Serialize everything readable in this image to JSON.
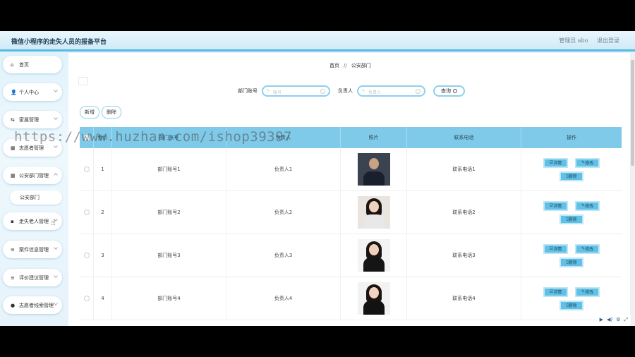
{
  "app_title": "微信小程序的走失人员的报备平台",
  "header": {
    "user_label": "管理员 abo",
    "logout": "退出登录"
  },
  "sidebar": {
    "items": [
      {
        "icon": "home-icon",
        "glyph": "⌂",
        "label": "首页"
      },
      {
        "icon": "user-icon",
        "glyph": "👤",
        "label": "个人中心"
      },
      {
        "icon": "family-icon",
        "glyph": "⇆",
        "label": "家属管理"
      },
      {
        "icon": "grid-icon",
        "glyph": "▦",
        "label": "志愿者管理"
      },
      {
        "icon": "grid-icon",
        "glyph": "▦",
        "label": "公安部门管理"
      },
      {
        "icon": "briefcase-icon",
        "glyph": "▪",
        "label": "走失老人管理"
      },
      {
        "icon": "list-icon",
        "glyph": "≡",
        "label": "案件信息管理"
      },
      {
        "icon": "list-icon",
        "glyph": "≡",
        "label": "评价建议管理"
      },
      {
        "icon": "bulb-icon",
        "glyph": "●",
        "label": "志愿者线索管理"
      }
    ],
    "sub_item": "公安部门"
  },
  "breadcrumb": {
    "home": "首页",
    "sep": "//",
    "current": "公安部门"
  },
  "search": {
    "field1_label": "部门账号",
    "field1_placeholder": "账号",
    "field2_label": "负责人",
    "field2_placeholder": "负责人",
    "query_button": "查询"
  },
  "actions": {
    "add": "新增",
    "delete": "删除"
  },
  "table": {
    "headers": {
      "index": "索引",
      "account": "部门账号",
      "manager": "负责人",
      "photo": "照片",
      "phone": "联系电话",
      "ops": "操作"
    },
    "rows": [
      {
        "index": "1",
        "account": "部门账号1",
        "manager": "负责人1",
        "phone": "联系电话1"
      },
      {
        "index": "2",
        "account": "部门账号2",
        "manager": "负责人2",
        "phone": "联系电话2"
      },
      {
        "index": "3",
        "account": "部门账号3",
        "manager": "负责人3",
        "phone": "联系电话3"
      },
      {
        "index": "4",
        "account": "部门账号4",
        "manager": "负责人4",
        "phone": "联系电话4"
      }
    ],
    "op_detail": "详情",
    "op_edit": "修改",
    "op_delete": "删除"
  },
  "watermark": "https://www.huzhan.com/ishop39397",
  "colors": {
    "header_accent": "#56bbe2",
    "table_head": "#7ecae8",
    "op_button": "#60c0e6"
  }
}
